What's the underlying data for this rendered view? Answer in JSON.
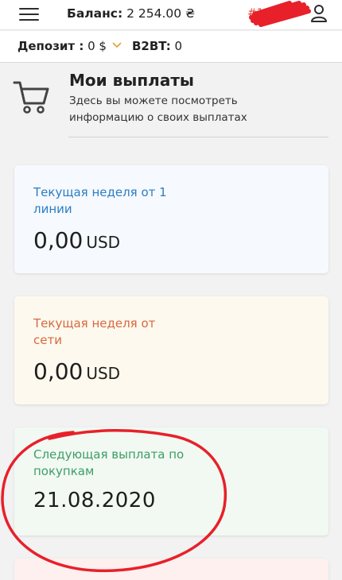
{
  "header": {
    "balance_label": "Баланс:",
    "balance_value": "2 254.00 ₴",
    "user_id_prefix": "#1"
  },
  "subheader": {
    "deposit_label": "Депозит :",
    "deposit_value": "0 $",
    "b2bt_label": "B2BT:",
    "b2bt_value": "0"
  },
  "page": {
    "title": "Мои выплаты",
    "description": "Здесь вы можете посмотреть информацию о своих выплатах"
  },
  "cards": [
    {
      "label": "Текущая неделя от 1 линии",
      "value": "0,00",
      "unit": "USD",
      "color": "#2a7ec5"
    },
    {
      "label": "Текущая неделя от сети",
      "value": "0,00",
      "unit": "USD",
      "color": "#d8683f"
    },
    {
      "label": "Следующая выплата по покупкам",
      "value": "21.08.2020",
      "color": "#3f9d67"
    }
  ],
  "icons": {
    "menu": "hamburger-menu-icon",
    "user": "user-icon",
    "cart": "shopping-cart-icon",
    "dropdown": "chevron-down-icon"
  },
  "colors": {
    "annotation": "#e8202a",
    "dropdown_chevron": "#e2a13a"
  }
}
